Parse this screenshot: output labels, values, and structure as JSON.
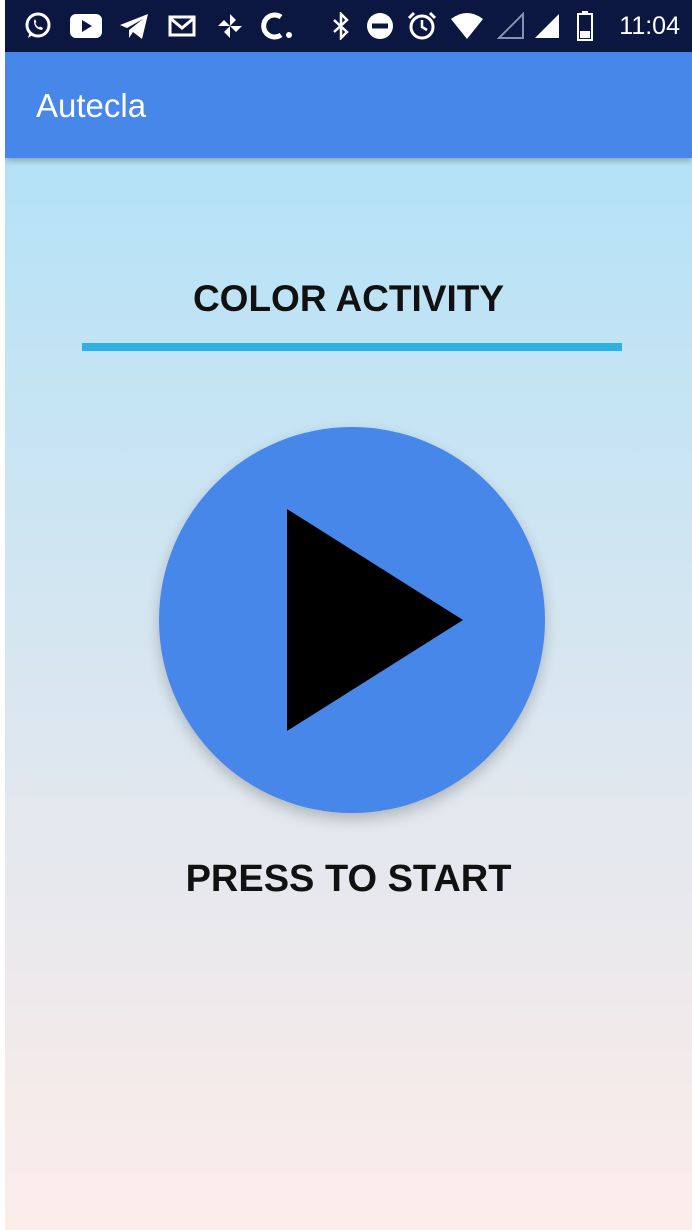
{
  "status_bar": {
    "time": "11:04",
    "icons": [
      "whatsapp-icon",
      "youtube-icon",
      "telegram-icon",
      "mail-icon",
      "pinwheel-icon",
      "c-icon",
      "bluetooth-icon",
      "do-not-disturb-icon",
      "alarm-icon",
      "wifi-icon",
      "signal-empty-icon",
      "signal-icon",
      "battery-icon"
    ]
  },
  "app_bar": {
    "title": "Autecla"
  },
  "main": {
    "activity_title": "COLOR ACTIVITY",
    "start_label": "PRESS TO START",
    "play_icon": "play-icon"
  },
  "colors": {
    "status_bar": "#0b1740",
    "app_bar": "#4787ea",
    "play_button": "#4787ea",
    "underline": "#2eb2e4",
    "gradient_top": "#b4e2f7",
    "gradient_bottom": "#fcede9"
  }
}
